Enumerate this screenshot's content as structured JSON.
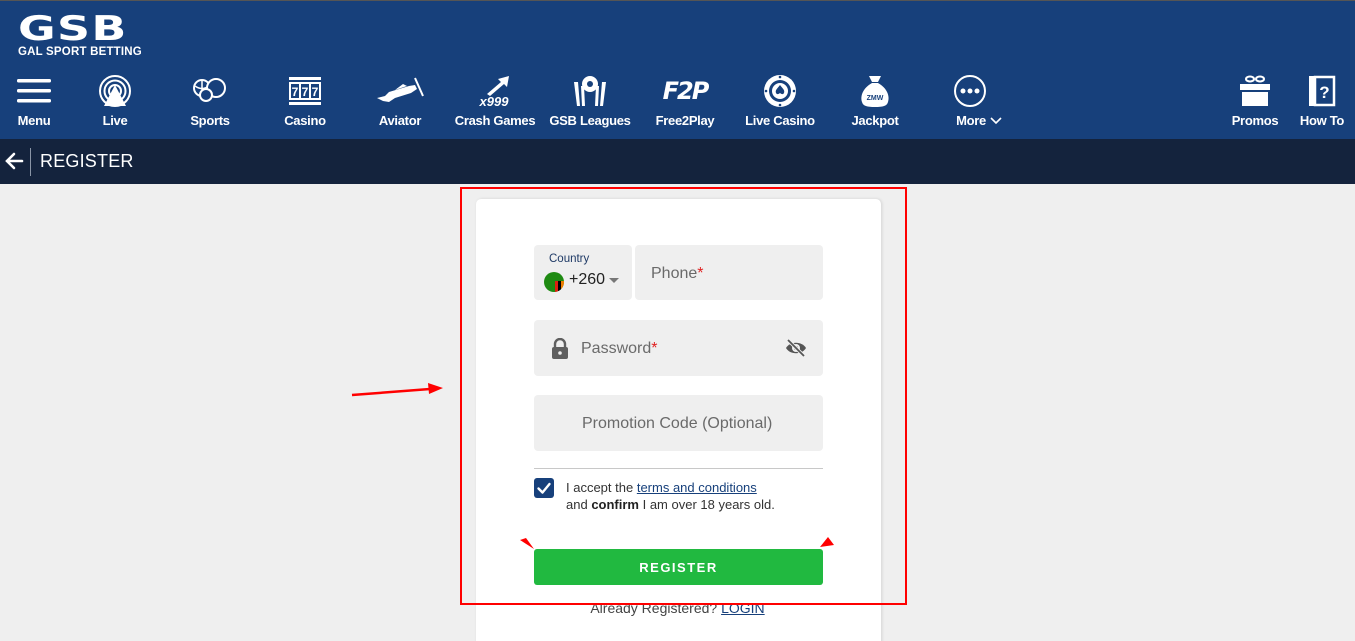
{
  "brand": {
    "logo_main": "GSB",
    "logo_sub": "GAL SPORT BETTING",
    "primary_color": "#17407b",
    "subbar_color": "#14233d",
    "accent_green": "#21b940"
  },
  "nav": {
    "items": [
      {
        "label": "Menu",
        "icon": "hamburger-icon"
      },
      {
        "label": "Live",
        "icon": "live-broadcast-icon"
      },
      {
        "label": "Sports",
        "icon": "sports-balls-icon"
      },
      {
        "label": "Casino",
        "icon": "slot-777-icon"
      },
      {
        "label": "Aviator",
        "icon": "airplane-icon"
      },
      {
        "label": "Crash Games",
        "icon": "crash-arrow-icon",
        "icon_text": "x999"
      },
      {
        "label": "GSB Leagues",
        "icon": "leagues-ball-icon"
      },
      {
        "label": "Free2Play",
        "icon": "f2p-icon",
        "icon_text": "F2P"
      },
      {
        "label": "Live Casino",
        "icon": "casino-chip-icon"
      },
      {
        "label": "Jackpot",
        "icon": "money-bag-icon",
        "icon_text": "ZMW"
      },
      {
        "label": "More",
        "icon": "more-dots-icon"
      },
      {
        "label": "Promos",
        "icon": "gift-icon"
      },
      {
        "label": "How To",
        "icon": "help-book-icon"
      }
    ]
  },
  "subheader": {
    "title": "REGISTER"
  },
  "form": {
    "country_label": "Country",
    "country_code": "+260",
    "country_flag": "zambia-flag",
    "phone_placeholder": "Phone",
    "password_placeholder": "Password",
    "promo_placeholder": "Promotion Code (Optional)",
    "required_mark": "*",
    "terms_checked": true,
    "terms_prefix": "I accept the ",
    "terms_link": "terms and conditions",
    "terms_line2_pre": "and ",
    "terms_bold": "confirm",
    "terms_line2_post": " I am over 18 years old.",
    "register_button": "REGISTER",
    "already_text": "Already Registered? ",
    "login_link": "LOGIN"
  }
}
